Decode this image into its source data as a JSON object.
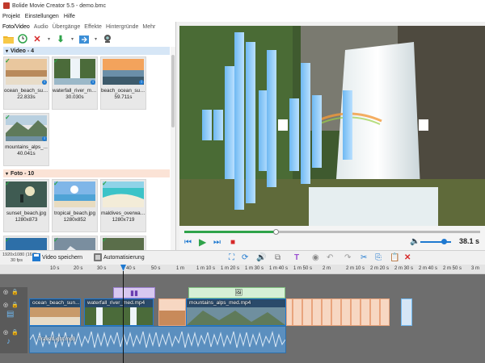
{
  "window": {
    "title": "Bolide Movie Creator 5.5 - demo.bmc"
  },
  "menu": [
    "Projekt",
    "Einstellungen",
    "Hilfe"
  ],
  "tabs": [
    "Foto/Video",
    "Audio",
    "Übergänge",
    "Effekte",
    "Hintergründe",
    "Mehr"
  ],
  "media": {
    "video_header": "Video - 4",
    "foto_header": "Foto - 10",
    "videos": [
      {
        "name": "ocean_beach_suns...",
        "meta": "22.833s"
      },
      {
        "name": "waterfall_river_me...",
        "meta": "30.030s"
      },
      {
        "name": "beach_ocean_suns...",
        "meta": "59.711s"
      },
      {
        "name": "mountains_alps_...",
        "meta": "40.041s"
      }
    ],
    "photos": [
      {
        "name": "sunset_beach.jpg",
        "meta": "1280x873"
      },
      {
        "name": "tropical_beach.jpg",
        "meta": "1280x852"
      },
      {
        "name": "maldives_overwat...",
        "meta": "1280x719"
      }
    ]
  },
  "player": {
    "time": "38.1 s",
    "progress": 0.31,
    "volume": 0.7
  },
  "editbar": {
    "resolution": "1920x1080 (16/9)",
    "fps": "30 fps",
    "save_label": "Video speichern",
    "auto_label": "Automatisierung"
  },
  "ruler": [
    "10 s",
    "20 s",
    "30 s",
    "40 s",
    "50 s",
    "1 m",
    "1 m 10 s",
    "1 m 20 s",
    "1 m 30 s",
    "1 m 40 s",
    "1 m 50 s",
    "2 m",
    "2 m 10 s",
    "2 m 20 s",
    "2 m 30 s",
    "2 m 40 s",
    "2 m 50 s",
    "3 m"
  ],
  "timeline": {
    "clips": [
      {
        "label": "ocean_beach_sun..."
      },
      {
        "label": "waterfall_river_med.mp4"
      },
      {
        "label": "mountains_alps_med.mp4"
      }
    ],
    "audio_label": "TravelLight.mp3"
  },
  "colors": {
    "accent": "#1f79d0",
    "green": "#2fa34a",
    "video_header_bg": "#d6e6f6",
    "foto_header_bg": "#fbe3d6"
  }
}
